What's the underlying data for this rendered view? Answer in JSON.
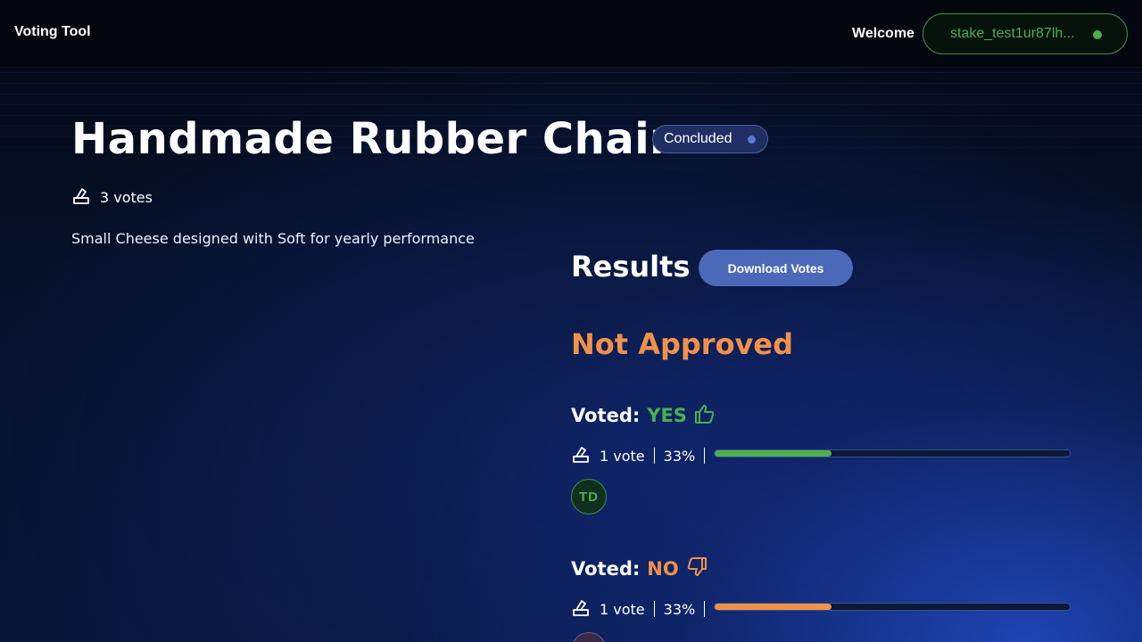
{
  "header": {
    "brand": "Voting Tool",
    "welcome": "Welcome",
    "wallet": "stake_test1ur87lh..."
  },
  "proposal": {
    "title": "Handmade Rubber Chair",
    "status": "Concluded",
    "total_votes": "3 votes",
    "description": "Small Cheese designed with Soft for yearly performance"
  },
  "results": {
    "title": "Results",
    "download_label": "Download Votes",
    "outcome": "Not Approved",
    "options": [
      {
        "voted_label": "Voted:",
        "choice": "YES",
        "votes": "1 vote",
        "percent_label": "33%",
        "fraction": 0.33,
        "color": "#4caf50",
        "avatar": "TD",
        "icon": "thumbs-up-icon"
      },
      {
        "voted_label": "Voted:",
        "choice": "NO",
        "votes": "1 vote",
        "percent_label": "33%",
        "fraction": 0.33,
        "color": "#f0914a",
        "avatar": "",
        "icon": "thumbs-down-icon"
      }
    ]
  },
  "colors": {
    "accent_blue": "#4b69b8",
    "yes_green": "#4caf50",
    "no_orange": "#f0914a"
  }
}
